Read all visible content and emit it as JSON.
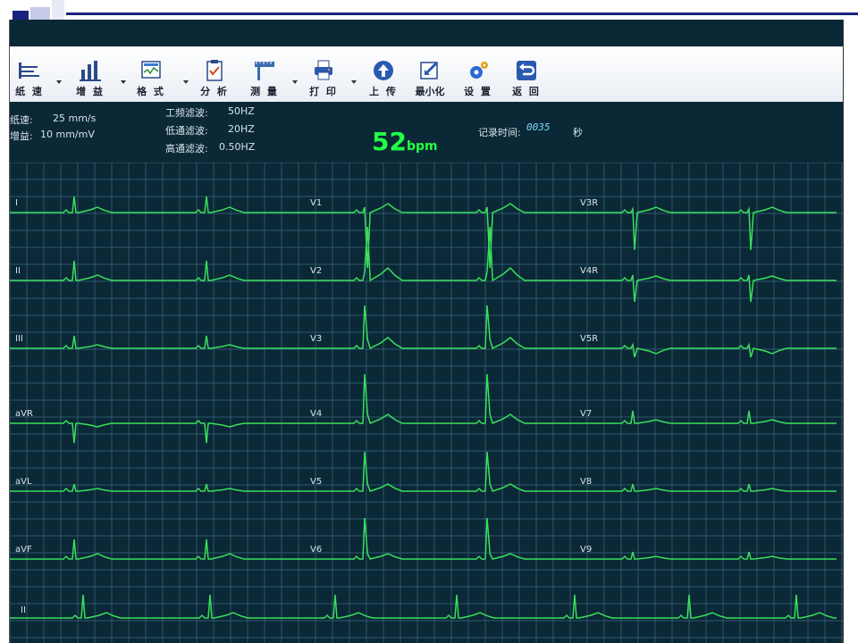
{
  "toolbar": {
    "items": [
      {
        "label": "纸 速",
        "icon": "paper-speed-icon"
      },
      {
        "label": "增 益",
        "icon": "gain-bars-icon"
      },
      {
        "label": "格 式",
        "icon": "format-icon"
      },
      {
        "label": "分 析",
        "icon": "analysis-clipboard-icon"
      },
      {
        "label": "测 量",
        "icon": "ruler-measure-icon"
      },
      {
        "label": "打 印",
        "icon": "printer-icon"
      },
      {
        "label": "上 传",
        "icon": "upload-arrow-icon"
      },
      {
        "label": "最小化",
        "icon": "minimize-icon"
      },
      {
        "label": "设 置",
        "icon": "gear-icon"
      },
      {
        "label": "返 回",
        "icon": "return-arrow-icon"
      }
    ]
  },
  "info": {
    "paper_speed_label": "纸速:",
    "paper_speed_value": "25 mm/s",
    "gain_label": "增益:",
    "gain_value": "10 mm/mV",
    "power_filter_label": "工频滤波:",
    "power_filter_value": "50HZ",
    "lowpass_label": "低通滤波:",
    "lowpass_value": "20HZ",
    "highpass_label": "高通滤波:",
    "highpass_value": "0.50HZ",
    "heart_rate": "52",
    "heart_rate_unit": "bpm",
    "record_time_label": "记录时间:",
    "record_time_value": "0035",
    "record_time_unit": "秒"
  },
  "leads": {
    "col1": [
      "I",
      "II",
      "III",
      "aVR",
      "aVL",
      "aVF"
    ],
    "col2": [
      "V1",
      "V2",
      "V3",
      "V4",
      "V5",
      "V6"
    ],
    "col3": [
      "V3R",
      "V4R",
      "V5R",
      "V7",
      "V8",
      "V9"
    ],
    "rhythm": "II"
  },
  "colors": {
    "screen_bg": "#0b2836",
    "grid": "#3a6a80",
    "trace": "#39e05a",
    "bpm": "#22ff44",
    "slide_navy": "#1a237e"
  }
}
